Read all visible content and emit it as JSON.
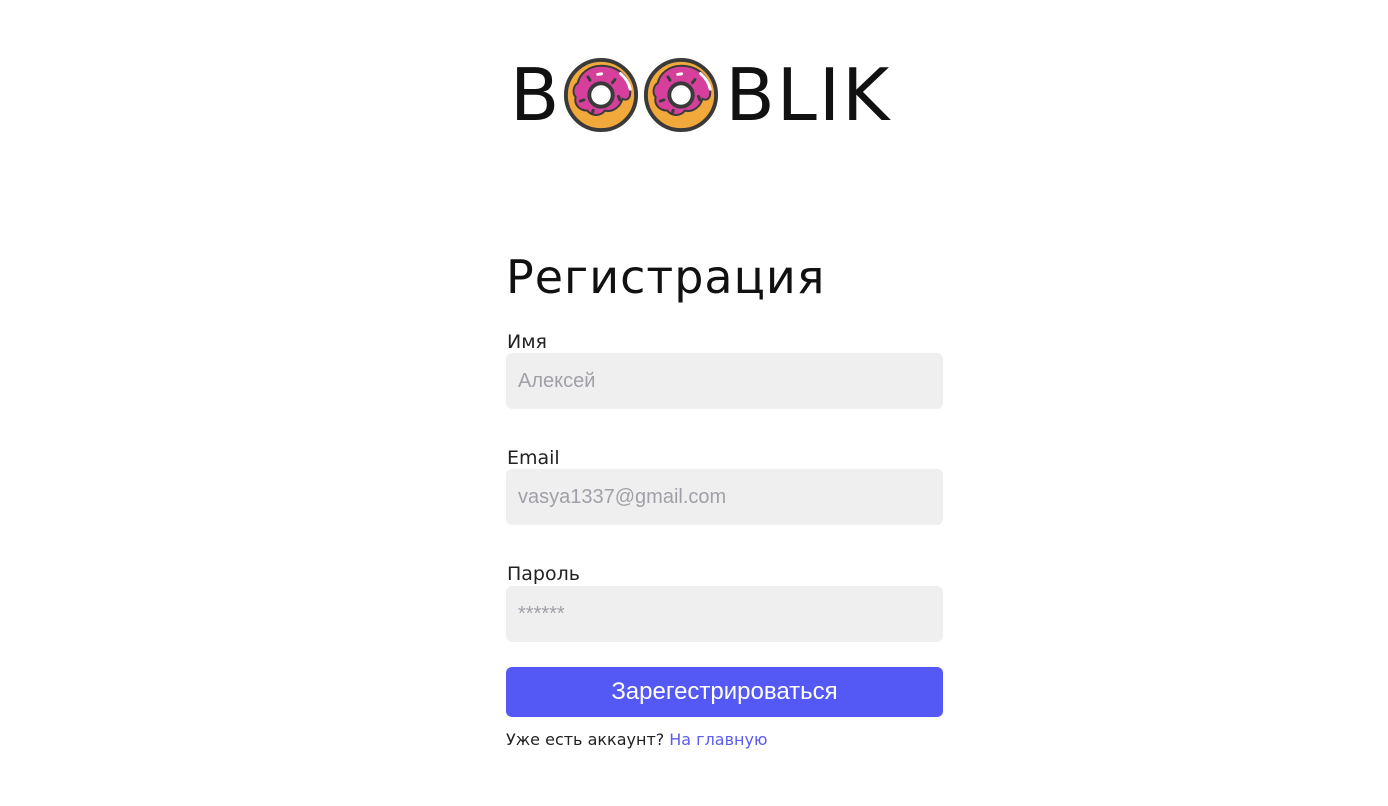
{
  "logo": {
    "prefix": "B",
    "suffix": "BLIK",
    "donut_count": 2,
    "colors": {
      "dough": "#f2a93b",
      "icing": "#d63f9b",
      "outline": "#3a3a3a"
    }
  },
  "form": {
    "title": "Регистрация",
    "fields": {
      "name": {
        "label": "Имя",
        "placeholder": "Алексей"
      },
      "email": {
        "label": "Email",
        "placeholder": "vasya1337@gmail.com"
      },
      "password": {
        "label": "Пароль",
        "placeholder": "******"
      }
    },
    "submit_label": "Зарегестрироваться",
    "accent": "#5458f5"
  },
  "footer": {
    "question": "Уже есть аккаунт?",
    "link_label": "На главную"
  }
}
